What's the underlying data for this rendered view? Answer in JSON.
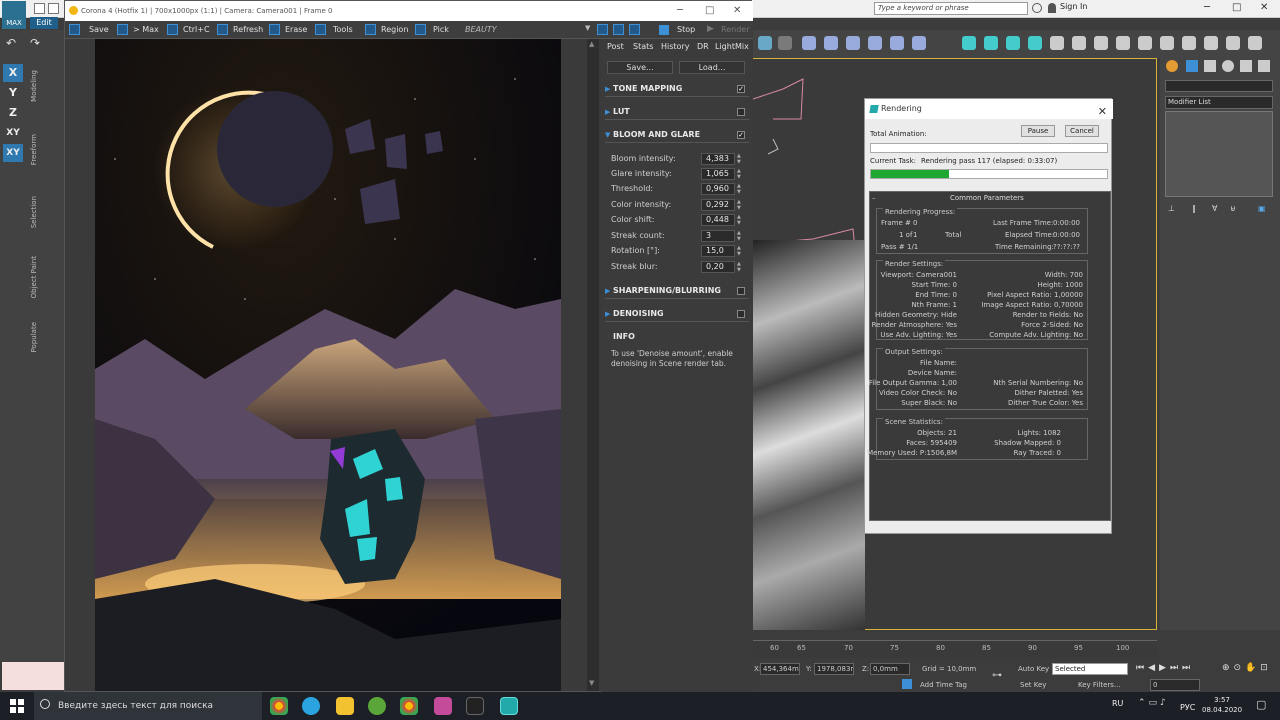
{
  "max": {
    "menu_edit": "Edit",
    "logo_text": "MAX",
    "search_placeholder": "Type a keyword or phrase",
    "sign_in": "Sign In",
    "axis_buttons": [
      "X",
      "Y",
      "Z",
      "XY",
      "XY"
    ],
    "side_tabs": [
      "Modeling",
      "Freeform",
      "Selection",
      "Object Paint",
      "Populate"
    ],
    "modifier_list": "Modifier List",
    "timeline_ticks": [
      "60",
      "65",
      "70",
      "75",
      "80",
      "85",
      "90",
      "95",
      "100"
    ],
    "coord_x": "454,364m",
    "coord_y": "1978,083m",
    "coord_z": "0,0mm",
    "grid": "Grid = 10,0mm",
    "auto_key": "Auto Key",
    "set_key": "Set Key",
    "selected": "Selected",
    "key_filters": "Key Filters...",
    "add_time_tag": "Add Time Tag",
    "frame": "0"
  },
  "vfb": {
    "title": "Corona 4 (Hotfix 1) | 700x1000px (1:1) | Camera: Camera001 | Frame 0",
    "toolbar": {
      "save": "Save",
      "max": "> Max",
      "ctrlc": "Ctrl+C",
      "refresh": "Refresh",
      "erase": "Erase",
      "tools": "Tools",
      "region": "Region",
      "pick": "Pick",
      "beauty": "BEAUTY",
      "stop": "Stop",
      "render": "Render"
    },
    "tabs": [
      "Post",
      "Stats",
      "History",
      "DR",
      "LightMix"
    ],
    "save_btn": "Save...",
    "load_btn": "Load...",
    "sections": {
      "tone_mapping": "TONE MAPPING",
      "lut": "LUT",
      "bloom": "BLOOM AND GLARE",
      "sharpening": "SHARPENING/BLURRING",
      "denoising": "DENOISING",
      "info": "INFO"
    },
    "check": "✓",
    "params": [
      {
        "label": "Bloom intensity:",
        "value": "4,383"
      },
      {
        "label": "Glare intensity:",
        "value": "1,065"
      },
      {
        "label": "Threshold:",
        "value": "0,960"
      },
      {
        "label": "Color intensity:",
        "value": "0,292"
      },
      {
        "label": "Color shift:",
        "value": "0,448"
      },
      {
        "label": "Streak count:",
        "value": "3"
      },
      {
        "label": "Rotation [°]:",
        "value": "15,0"
      },
      {
        "label": "Streak blur:",
        "value": "0,20"
      }
    ],
    "info_text": "To use 'Denoise amount', enable denoising in Scene render tab."
  },
  "rendering": {
    "title": "Rendering",
    "pause": "Pause",
    "cancel": "Cancel",
    "total_animation": "Total Animation:",
    "current_task_label": "Current Task:",
    "current_task": "Rendering pass 117 (elapsed: 0:33:07)",
    "progress_fraction": 0.33,
    "common_params": "Common Parameters",
    "rp_title": "Rendering Progress:",
    "frame_label": "Frame #",
    "frame_val": "0",
    "of_label": "1 of",
    "of_val": "1",
    "total": "Total",
    "pass_label": "Pass #",
    "pass_val": "1/1",
    "last_frame_label": "Last Frame Time:",
    "last_frame_val": "0:00:00",
    "elapsed_label": "Elapsed Time:",
    "elapsed_val": "0:00:00",
    "remaining_label": "Time Remaining:",
    "remaining_val": "??:??:??",
    "rs_title": "Render Settings:",
    "rs_left": [
      "Viewport: Camera001",
      "Start Time: 0",
      "End Time: 0",
      "Nth Frame: 1",
      "Hidden Geometry: Hide",
      "Render Atmosphere: Yes",
      "Use Adv. Lighting: Yes"
    ],
    "rs_right": [
      "Width: 700",
      "Height: 1000",
      "Pixel Aspect Ratio: 1,00000",
      "Image Aspect Ratio: 0,70000",
      "Render to Fields: No",
      "Force 2-Sided: No",
      "Compute Adv. Lighting: No"
    ],
    "os_title": "Output Settings:",
    "os_left": [
      "File Name:",
      "Device Name:",
      "File Output Gamma: 1,00",
      "Video Color Check: No",
      "Super Black: No"
    ],
    "os_right": [
      "Nth Serial Numbering: No",
      "Dither Paletted: Yes",
      "Dither True Color: Yes"
    ],
    "ss_title": "Scene Statistics:",
    "ss_left": [
      "Objects: 21",
      "Faces: 595409",
      "Memory Used: P:1506,8M"
    ],
    "ss_right": [
      "Lights: 1082",
      "Shadow Mapped: 0",
      "Ray Traced: 0"
    ]
  },
  "taskbar": {
    "search": "Введите здесь текст для поиска",
    "lang": "RU",
    "ime": "РУС",
    "time": "3:57",
    "date": "08.04.2020"
  },
  "colors": {
    "accent": "#3d8fd6",
    "progress": "#1fa82f",
    "viewport_border": "#d8b33a"
  }
}
